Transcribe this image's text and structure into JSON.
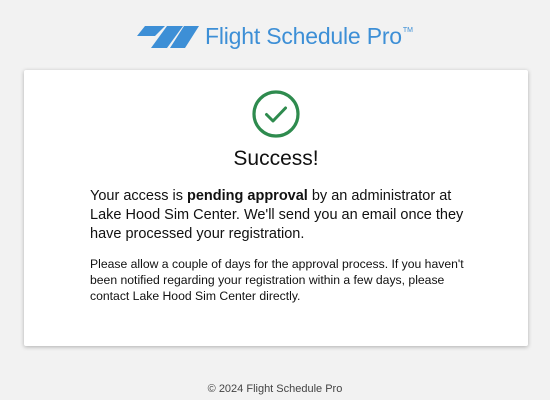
{
  "brand": {
    "name": "Flight Schedule Pro",
    "trademark": "TM",
    "color": "#3d8fd6"
  },
  "status": {
    "icon": "check-circle-icon",
    "color": "#2e8b4e",
    "title": "Success!"
  },
  "message": {
    "para1_prefix": "Your access is ",
    "para1_bold": "pending approval",
    "para1_suffix": " by an administrator at Lake Hood Sim Center. We'll send you an email once they have processed your registration.",
    "para2": "Please allow a couple of days for the approval process. If you haven't been notified regarding your registration within a few days, please contact Lake Hood Sim Center directly."
  },
  "footer": {
    "copyright": "© 2024 Flight Schedule Pro"
  }
}
